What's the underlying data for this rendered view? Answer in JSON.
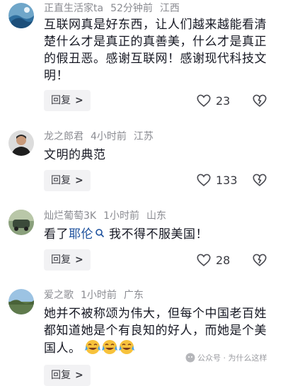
{
  "comments": [
    {
      "user": "正直生活家ta",
      "time": "52分钟前",
      "location": "江西",
      "text": "互联网真是好东西，让人们越来越能看清楚什么才是真正的真善美，什么才是真正的假丑恶。感谢互联网！感谢现代科技文明！",
      "reply_label": "回复",
      "likes": "23"
    },
    {
      "user": "龙之郎君",
      "time": "4小时前",
      "location": "江苏",
      "text": "文明的典范",
      "reply_label": "回复",
      "likes": "133"
    },
    {
      "user": "灿烂葡萄3K",
      "time": "1小时前",
      "location": "山东",
      "text_prefix": "看了",
      "text_link": "耶伦",
      "text_suffix": "我不得不服美国！",
      "reply_label": "回复",
      "likes": "28"
    },
    {
      "user": "爱之歌",
      "time": "1小时前",
      "location": "广东",
      "text": "她并不被称颂为伟大，但每个中国老百姓都知道她是个有良知的好人，而她是个美国人。",
      "reply_label": "回复"
    }
  ],
  "watermark": "公众号 · 为什么这样",
  "colors": {
    "text": "#161823",
    "meta": "#8a8b91",
    "reply_bg": "#f2f2f4",
    "link": "#1b4f9c"
  }
}
